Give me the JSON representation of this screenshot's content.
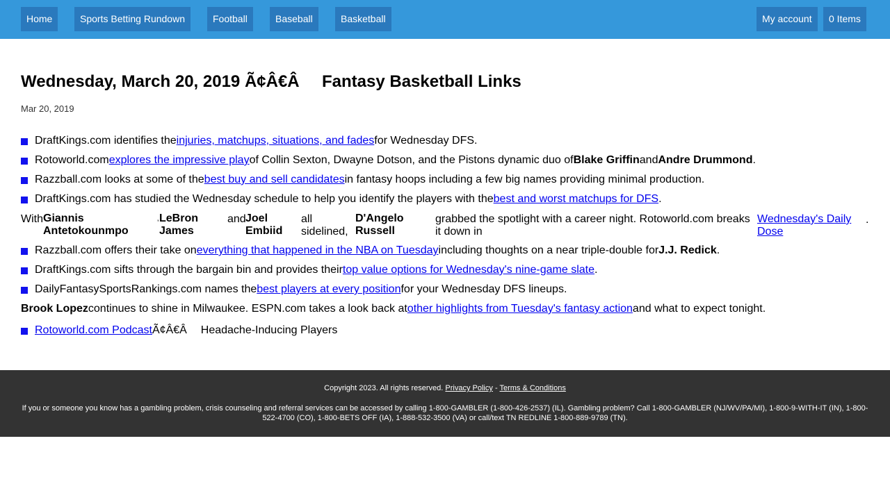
{
  "nav": {
    "home": "Home",
    "rundown": "Sports Betting Rundown",
    "football": "Football",
    "baseball": "Baseball",
    "basketball": "Basketball",
    "account": "My account",
    "cart": "0 Items"
  },
  "article": {
    "title_part1": "Wednesday, March 20, 2019 Ã¢Â€Â",
    "title_part2": "Fantasy Basketball Links",
    "date": "Mar 20, 2019"
  },
  "items": [
    {
      "pre": "DraftKings.com identifies the",
      "link": "injuries, matchups, situations, and fades",
      "post": "for Wednesday DFS."
    },
    {
      "pre": "Rotoworld.com",
      "link": "explores the impressive play",
      "mid": "of Collin Sexton, Dwayne Dotson, and the Pistons dynamic duo of",
      "b1": "Blake Griffin",
      "and": "and",
      "b2": "Andre Drummond",
      "end": "."
    },
    {
      "pre": "Razzball.com looks at some of the",
      "link": "best buy and sell candidates",
      "post": "in fantasy hoops including a few big names providing minimal production."
    },
    {
      "pre": "DraftKings.com has studied the Wednesday schedule to help you identify the players with the",
      "link": "best and worst matchups for DFS",
      "post": "."
    }
  ],
  "giannis_row": {
    "with": "With",
    "b1": "Giannis Antetokounmpo",
    "apos": "’",
    "b2": "LeBron James",
    "and": "and",
    "b3": "Joel Embiid",
    "sidelined": "all sidelined,",
    "b4": "D'Angelo Russell",
    "text": "grabbed the spotlight with a career night. Rotoworld.com breaks it down in",
    "link": "Wednesday's Daily Dose",
    "end": "."
  },
  "items2": [
    {
      "pre": "Razzball.com offers their take on",
      "link": "everything that happened in the NBA on Tuesday",
      "post": "including thoughts on a near triple-double for",
      "b1": "J.J. Redick",
      "end": "."
    },
    {
      "pre": "DraftKings.com sifts through the bargain bin and provides their",
      "link": "top value options for Wednesday's nine-game slate",
      "post": "."
    },
    {
      "pre": "DailyFantasySportsRankings.com names the",
      "link": "best players at every position",
      "post": "for your Wednesday DFS lineups."
    }
  ],
  "brook_row": {
    "b1": "Brook Lopez",
    "pre": "continues to shine in Milwaukee. ESPN.com takes a look back at",
    "link": "other highlights from Tuesday's fantasy action",
    "post": "and what to expect tonight."
  },
  "podcast_row": {
    "link": "Rotoworld.com Podcast",
    "mid": "Ã¢Â€Â",
    "post": "Headache-Inducing Players"
  },
  "footer": {
    "copyright": "Copyright 2023. All rights reserved.",
    "privacy": "Privacy Policy",
    "sep": "-",
    "terms": "Terms & Conditions",
    "disclaimer": "If you or someone you know has a gambling problem, crisis counseling and referral services can be accessed by calling 1-800-GAMBLER (1-800-426-2537) (IL). Gambling problem? Call 1-800-GAMBLER (NJ/WV/PA/MI), 1-800-9-WITH-IT (IN), 1-800-522-4700 (CO), 1-800-BETS OFF (IA), 1-888-532-3500 (VA) or call/text TN REDLINE 1-800-889-9789 (TN)."
  },
  "colors": {
    "nav_bg": "#3598db",
    "nav_button": "#2a79bd",
    "bullet": "#1212ee",
    "link": "#0000ee",
    "footer_bg": "#333333"
  }
}
